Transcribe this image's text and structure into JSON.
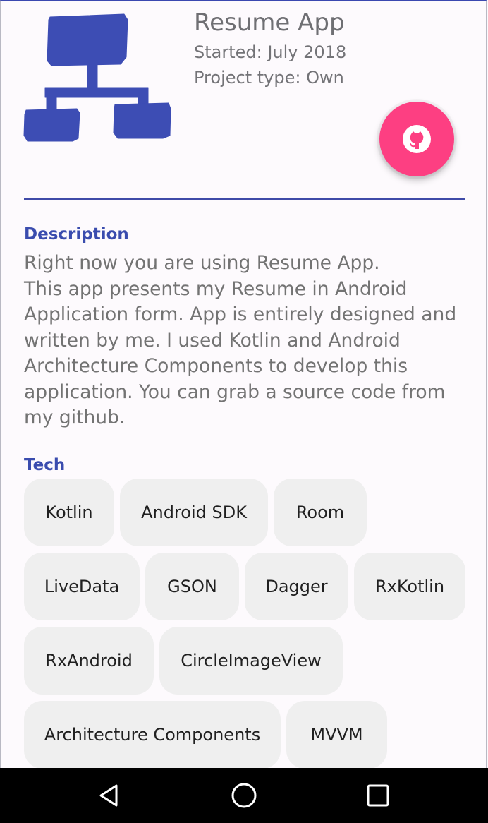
{
  "project": {
    "title": "Resume App",
    "started": "Started: July 2018",
    "project_type": "Project type: Own",
    "accent_color": "#3a4cae",
    "fab_color": "#fd3f82",
    "logo_icon": "sitemap-icon",
    "fab_icon": "github-icon"
  },
  "description": {
    "heading": "Description",
    "text": "Right now you are using Resume App.\nThis app presents my Resume in Android Application form. App is entirely designed and written by me. I used Kotlin and Android Architecture Components to develop this application. You can grab a source code from my github."
  },
  "tech": {
    "heading": "Tech",
    "chips": [
      "Kotlin",
      "Android SDK",
      "Room",
      "LiveData",
      "GSON",
      "Dagger",
      "RxKotlin",
      "RxAndroid",
      "CircleImageView",
      "Architecture Components",
      "MVVM"
    ]
  },
  "navbar": {
    "icons": [
      "back-icon",
      "home-icon",
      "recents-icon"
    ]
  }
}
